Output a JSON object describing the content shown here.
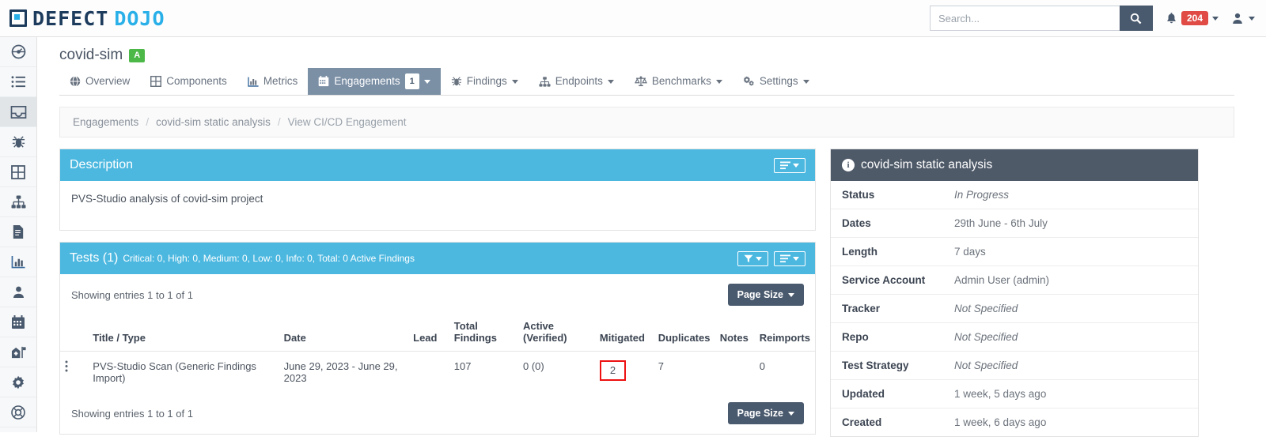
{
  "brand": {
    "defect": "DEFECT",
    "dojo": "DOJO",
    "mark_icon": "defectdojo-logo-icon"
  },
  "search": {
    "placeholder": "Search...",
    "value": "",
    "icon": "search-icon"
  },
  "notifications": {
    "count": "204",
    "icon": "bell-icon"
  },
  "user": {
    "icon": "user-icon"
  },
  "sidebar": {
    "items": [
      {
        "icon": "dashboard-icon",
        "name": "sidebar-item-dashboard",
        "active": false
      },
      {
        "icon": "list-icon",
        "name": "sidebar-item-list",
        "active": false
      },
      {
        "icon": "inbox-icon",
        "name": "sidebar-item-engagements",
        "active": true
      },
      {
        "icon": "bug-icon",
        "name": "sidebar-item-findings",
        "active": false
      },
      {
        "icon": "grid-icon",
        "name": "sidebar-item-components",
        "active": false
      },
      {
        "icon": "sitemap-icon",
        "name": "sidebar-item-endpoints",
        "active": false
      },
      {
        "icon": "document-icon",
        "name": "sidebar-item-reports",
        "active": false
      },
      {
        "icon": "bar-chart-icon",
        "name": "sidebar-item-metrics",
        "active": false
      },
      {
        "icon": "user-icon",
        "name": "sidebar-item-users",
        "active": false
      },
      {
        "icon": "calendar-icon",
        "name": "sidebar-item-calendar",
        "active": false
      },
      {
        "icon": "building-flag-icon",
        "name": "sidebar-item-organization",
        "active": false
      },
      {
        "icon": "gear-icon",
        "name": "sidebar-item-settings",
        "active": false
      },
      {
        "icon": "lifebuoy-icon",
        "name": "sidebar-item-support",
        "active": false
      }
    ]
  },
  "page": {
    "title": "covid-sim",
    "grade": "A"
  },
  "tabs": [
    {
      "label": "Overview",
      "icon": "globe-icon",
      "active": false,
      "caret": false,
      "badge": ""
    },
    {
      "label": "Components",
      "icon": "grid-icon",
      "active": false,
      "caret": false,
      "badge": ""
    },
    {
      "label": "Metrics",
      "icon": "bar-chart-icon",
      "active": false,
      "caret": false,
      "badge": ""
    },
    {
      "label": "Engagements",
      "icon": "calendar-icon",
      "active": true,
      "caret": true,
      "badge": "1"
    },
    {
      "label": "Findings",
      "icon": "bug-icon",
      "active": false,
      "caret": true,
      "badge": ""
    },
    {
      "label": "Endpoints",
      "icon": "sitemap-icon",
      "active": false,
      "caret": true,
      "badge": ""
    },
    {
      "label": "Benchmarks",
      "icon": "scales-icon",
      "active": false,
      "caret": true,
      "badge": ""
    },
    {
      "label": "Settings",
      "icon": "gears-icon",
      "active": false,
      "caret": true,
      "badge": ""
    }
  ],
  "breadcrumb": {
    "items": [
      "Engagements",
      "covid-sim static analysis",
      "View CI/CD Engagement"
    ],
    "separator": "/"
  },
  "description_panel": {
    "title": "Description",
    "menu_icon": "hamburger-menu-icon",
    "body": "PVS-Studio analysis of covid-sim project"
  },
  "tests_panel": {
    "title": "Tests (1)",
    "subtitle": "Critical: 0, High: 0, Medium: 0, Low: 0, Info: 0, Total: 0 Active Findings",
    "filter_icon": "filter-funnel-icon",
    "menu_icon": "hamburger-menu-icon",
    "showing_top": "Showing entries 1 to 1 of 1",
    "showing_bottom": "Showing entries 1 to 1 of 1",
    "page_size_label": "Page Size",
    "columns": [
      "Title / Type",
      "Date",
      "Lead",
      "Total Findings",
      "Active (Verified)",
      "Mitigated",
      "Duplicates",
      "Notes",
      "Reimports"
    ],
    "columns_split": [
      {
        "l1": "",
        "l2": "Title / Type"
      },
      {
        "l1": "",
        "l2": "Date"
      },
      {
        "l1": "",
        "l2": "Lead"
      },
      {
        "l1": "Total",
        "l2": "Findings"
      },
      {
        "l1": "Active",
        "l2": "(Verified)"
      },
      {
        "l1": "",
        "l2": "Mitigated"
      },
      {
        "l1": "",
        "l2": "Duplicates"
      },
      {
        "l1": "",
        "l2": "Notes"
      },
      {
        "l1": "",
        "l2": "Reimports"
      }
    ],
    "rows": [
      {
        "menu_icon": "kebab-menu-icon",
        "title": "PVS-Studio Scan (Generic Findings Import)",
        "date": "June 29, 2023 - June 29, 2023",
        "lead": "",
        "total_findings": "107",
        "active_verified": "0  (0)",
        "mitigated": "2",
        "mitigated_highlighted": true,
        "duplicates": "7",
        "notes": "",
        "reimports": "0"
      }
    ]
  },
  "info_panel": {
    "title": "covid-sim static analysis",
    "icon": "info-circle-icon",
    "rows": [
      {
        "label": "Status",
        "value": "In Progress",
        "italic": true
      },
      {
        "label": "Dates",
        "value": "29th June - 6th July",
        "italic": false
      },
      {
        "label": "Length",
        "value": "7 days",
        "italic": false
      },
      {
        "label": "Service Account",
        "value": "Admin User (admin)",
        "italic": false
      },
      {
        "label": "Tracker",
        "value": "Not Specified",
        "italic": true
      },
      {
        "label": "Repo",
        "value": "Not Specified",
        "italic": true
      },
      {
        "label": "Test Strategy",
        "value": "Not Specified",
        "italic": true
      },
      {
        "label": "Updated",
        "value": "1 week, 5 days ago",
        "italic": false
      },
      {
        "label": "Created",
        "value": "1 week, 6 days ago",
        "italic": false
      }
    ]
  },
  "colors": {
    "brand_dark": "#1d3b5c",
    "brand_cyan": "#2ab0e8",
    "panel_blue": "#4cb8e0",
    "panel_dark": "#4f5a69",
    "slate": "#4a5a6e",
    "tab_active": "#7b8fa5",
    "badge_red": "#e04b45",
    "grade_green": "#4cb847",
    "highlight_red": "#ee1111"
  }
}
